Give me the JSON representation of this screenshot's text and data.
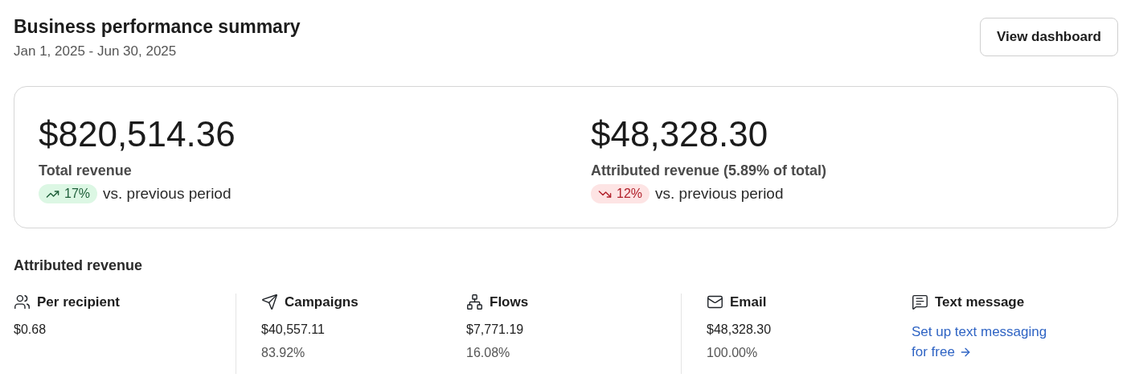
{
  "header": {
    "title": "Business performance summary",
    "date_range": "Jan 1, 2025 - Jun 30, 2025",
    "button": "View dashboard"
  },
  "summary": [
    {
      "value": "$820,514.36",
      "label": "Total revenue",
      "trend": {
        "up": true,
        "change": "17%"
      },
      "comparison": "vs. previous period"
    },
    {
      "value": "$48,328.30",
      "label": "Attributed revenue (5.89% of total)",
      "trend": {
        "up": false,
        "change": "12%"
      },
      "comparison": "vs. previous period"
    }
  ],
  "attributed": {
    "title": "Attributed revenue",
    "groups": [
      [
        {
          "kind": "stat",
          "label": "Per recipient",
          "value": "$0.68"
        }
      ],
      [
        {
          "kind": "stat",
          "label": "Campaigns",
          "value": "$40,557.11",
          "share": "83.92%"
        },
        {
          "kind": "stat",
          "label": "Flows",
          "value": "$7,771.19",
          "share": "16.08%"
        }
      ],
      [
        {
          "kind": "stat",
          "label": "Email",
          "value": "$48,328.30",
          "share": "100.00%"
        },
        {
          "kind": "link",
          "label": "Text message",
          "link": "Set up text messaging for free"
        }
      ]
    ]
  }
}
